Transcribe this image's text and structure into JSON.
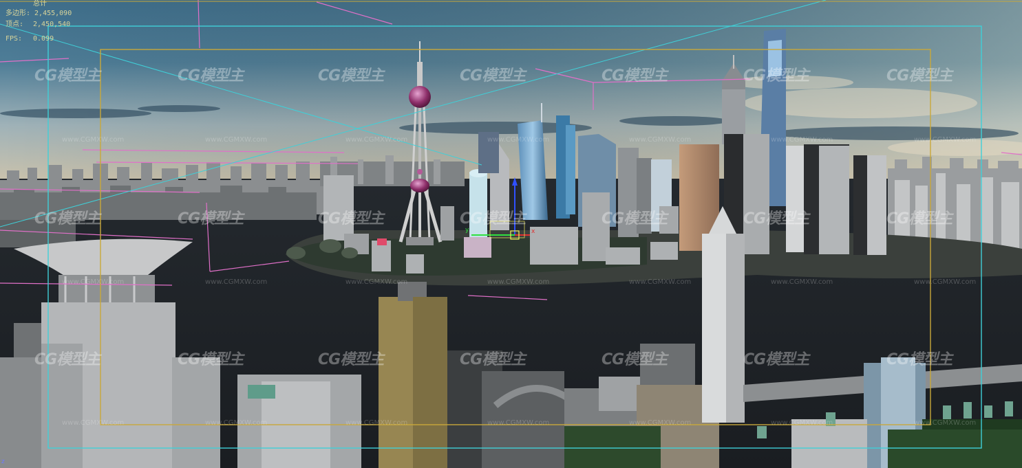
{
  "viewport": {
    "stats": {
      "header": "总计",
      "polygons_label": "多边形:",
      "polygons_value": "2,455,090",
      "vertices_label": "顶点:",
      "vertices_value": "2,450,540",
      "fps_label": "FPS:",
      "fps_value": "0.099"
    },
    "watermark_text": "CG模型主",
    "watermark_url": "www.CGMXW.com",
    "gizmo": {
      "x_label": "x",
      "y_label": "y",
      "z_label": "z"
    },
    "colors": {
      "stats_text": "#d8d49a",
      "safe_frame_outer": "#3fd0d8",
      "safe_frame_inner": "#c9a83a",
      "camera_lines": "#e070c8",
      "gizmo_x": "#e03030",
      "gizmo_y": "#30e040",
      "gizmo_z": "#3050ff",
      "selection": "#f4f060"
    }
  }
}
